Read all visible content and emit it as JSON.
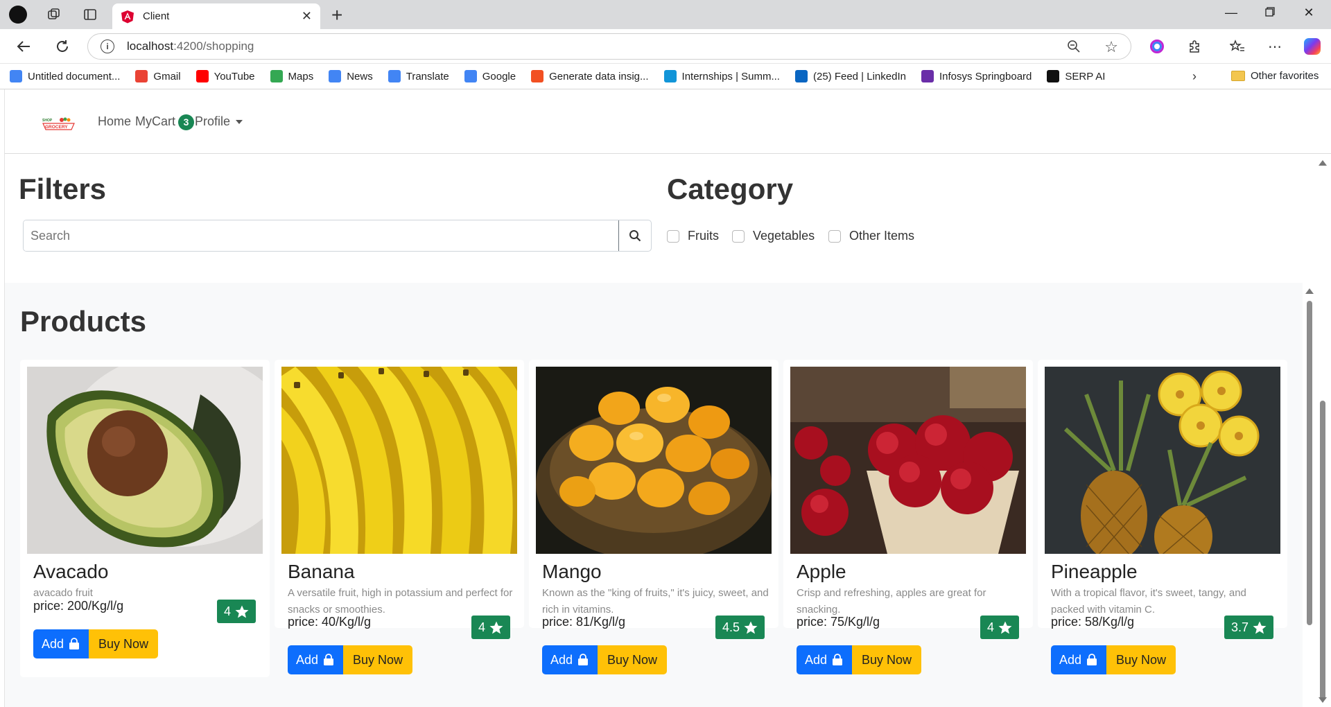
{
  "browser": {
    "tab_title": "Client",
    "url_host": "localhost",
    "url_path": ":4200/shopping",
    "bookmarks": [
      {
        "label": "Untitled document...",
        "icon": "docs-icon",
        "color": "#4285f4"
      },
      {
        "label": "Gmail",
        "icon": "gmail-icon",
        "color": "#ea4335"
      },
      {
        "label": "YouTube",
        "icon": "youtube-icon",
        "color": "#ff0000"
      },
      {
        "label": "Maps",
        "icon": "maps-icon",
        "color": "#34a853"
      },
      {
        "label": "News",
        "icon": "news-icon",
        "color": "#4285f4"
      },
      {
        "label": "Translate",
        "icon": "translate-icon",
        "color": "#4285f4"
      },
      {
        "label": "Google",
        "icon": "google-icon",
        "color": "#4285f4"
      },
      {
        "label": "Generate data insig...",
        "icon": "grid-icon",
        "color": "#f25022"
      },
      {
        "label": "Internships | Summ...",
        "icon": "internshala-icon",
        "color": "#1295d8"
      },
      {
        "label": "(25) Feed | LinkedIn",
        "icon": "linkedin-icon",
        "color": "#0a66c2"
      },
      {
        "label": "Infosys Springboard",
        "icon": "springboard-icon",
        "color": "#6a2ea8"
      },
      {
        "label": "SERP AI",
        "icon": "serp-icon",
        "color": "#111111"
      }
    ],
    "other_favorites": "Other favorites"
  },
  "navbar": {
    "home": "Home",
    "mycart": "MyCart",
    "cart_count": "3",
    "profile": "Profile"
  },
  "filters": {
    "title": "Filters",
    "search_placeholder": "Search",
    "category_title": "Category",
    "categories": [
      "Fruits",
      "Vegetables",
      "Other Items"
    ]
  },
  "products": {
    "title": "Products",
    "add_label": "Add",
    "buy_label": "Buy Now",
    "items": [
      {
        "name": "Avacado",
        "desc": "avacado fruit",
        "price": "price: 200/Kg/l/g",
        "rating": "4"
      },
      {
        "name": "Banana",
        "desc": "A versatile fruit, high in potassium and perfect for snacks or smoothies.",
        "price": "price: 40/Kg/l/g",
        "rating": "4"
      },
      {
        "name": "Mango",
        "desc": "Known as the \"king of fruits,\" it's juicy, sweet, and rich in vitamins.",
        "price": "price: 81/Kg/l/g",
        "rating": "4.5"
      },
      {
        "name": "Apple",
        "desc": "Crisp and refreshing, apples are great for snacking.",
        "price": "price: 75/Kg/l/g",
        "rating": "4"
      },
      {
        "name": "Pineapple",
        "desc": "With a tropical flavor, it's sweet, tangy, and packed with vitamin C.",
        "price": "price: 58/Kg/l/g",
        "rating": "3.7"
      }
    ]
  },
  "colors": {
    "primary": "#0d6efd",
    "success": "#198754",
    "warning": "#ffc107"
  }
}
